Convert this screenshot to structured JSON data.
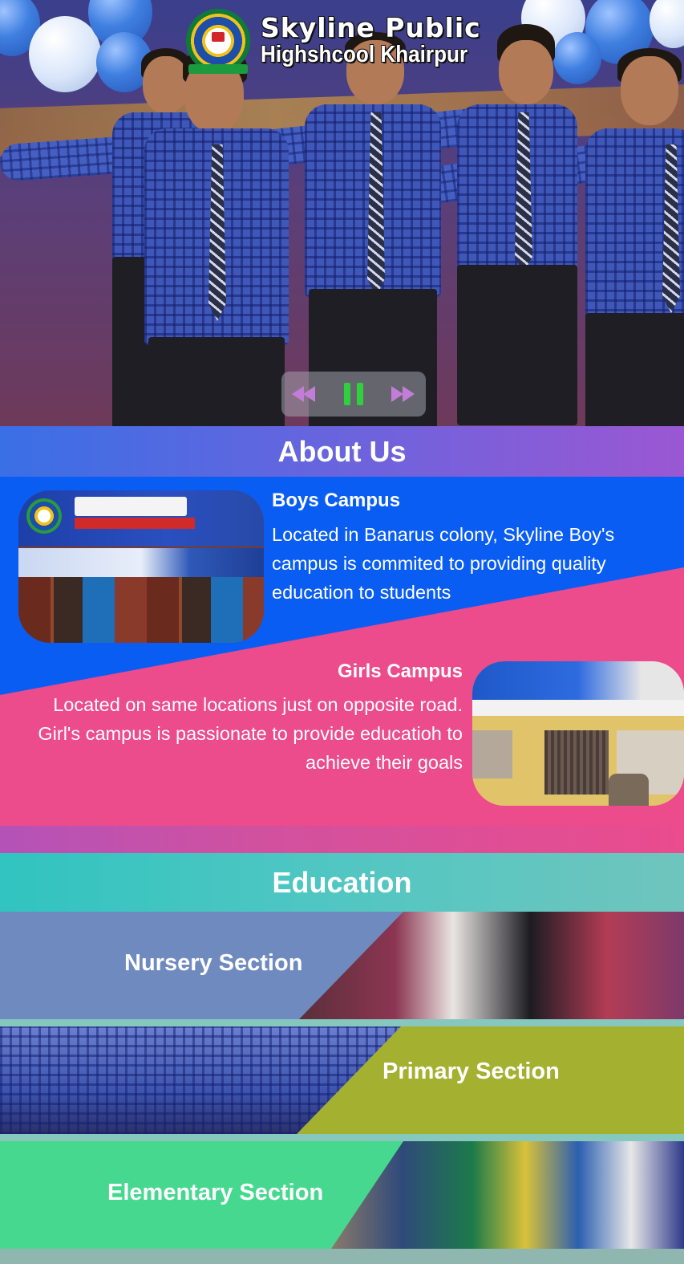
{
  "brand": {
    "line1": "Skyline Public",
    "line2": "Highshcool Khairpur"
  },
  "slider": {
    "controls": [
      "rewind-icon",
      "pause-icon",
      "fast-forward-icon"
    ]
  },
  "about": {
    "title": "About Us",
    "boys": {
      "title": "Boys Campus",
      "description": "Located in Banarus colony, Skyline Boy's campus is commited to providing quality education to students"
    },
    "girls": {
      "title": "Girls Campus",
      "description": "Located on same locations just on opposite road. Girl's campus is passionate to provide educatioh to achieve their goals"
    }
  },
  "education": {
    "title": "Education",
    "sections": [
      "Nursery Section",
      "Primary Section",
      "Elementary Section"
    ]
  },
  "colors": {
    "about_blue": "#0a5df2",
    "about_pink": "#ec4b8c",
    "education_teal": "#31c4c0",
    "nursery": "#6f8abf",
    "primary": "#a4b030",
    "elementary": "#47d88f",
    "pause_green": "#2fcf3e",
    "nav_arrow_purple": "#c17dd8"
  }
}
